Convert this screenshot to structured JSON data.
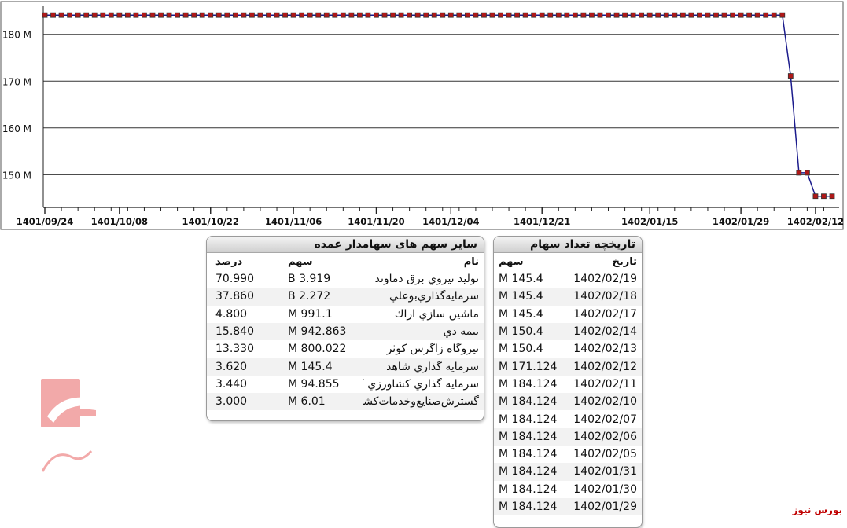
{
  "chart_data": {
    "type": "line",
    "y_ticks": [
      "180 M",
      "170 M",
      "160 M",
      "150 M"
    ],
    "y_tick_values": [
      180,
      170,
      160,
      150
    ],
    "ylim": [
      143,
      186
    ],
    "grid": true,
    "x_tick_labels": [
      "1401/09/24",
      "1401/10/08",
      "1401/10/22",
      "1401/11/06",
      "1401/11/20",
      "1401/12/04",
      "1401/12/21",
      "1402/01/15",
      "1402/01/29",
      "1402/02/12"
    ],
    "series": [
      {
        "color": "#1b1b8c",
        "marker_color": "#b01818",
        "values": [
          184.124,
          184.124,
          184.124,
          184.124,
          184.124,
          184.124,
          184.124,
          184.124,
          184.124,
          184.124,
          184.124,
          184.124,
          184.124,
          184.124,
          184.124,
          184.124,
          184.124,
          184.124,
          184.124,
          184.124,
          184.124,
          184.124,
          184.124,
          184.124,
          184.124,
          184.124,
          184.124,
          184.124,
          184.124,
          184.124,
          184.124,
          184.124,
          184.124,
          184.124,
          184.124,
          184.124,
          184.124,
          184.124,
          184.124,
          184.124,
          184.124,
          184.124,
          184.124,
          184.124,
          184.124,
          184.124,
          184.124,
          184.124,
          184.124,
          184.124,
          184.124,
          184.124,
          184.124,
          184.124,
          184.124,
          184.124,
          184.124,
          184.124,
          184.124,
          184.124,
          184.124,
          184.124,
          184.124,
          184.124,
          184.124,
          184.124,
          184.124,
          184.124,
          184.124,
          184.124,
          184.124,
          184.124,
          184.124,
          184.124,
          184.124,
          184.124,
          184.124,
          184.124,
          184.124,
          184.124,
          184.124,
          184.124,
          184.124,
          184.124,
          184.124,
          184.124,
          184.124,
          184.124,
          184.124,
          184.124,
          171.124,
          150.4,
          150.4,
          145.4,
          145.4,
          145.4
        ]
      }
    ]
  },
  "holders": {
    "title": "ساير سهم هاى سهامدار عمده",
    "headers": {
      "name": "نام",
      "share": "سهم",
      "pct": "درصد"
    },
    "rows": [
      {
        "name": "توليد نيروي برق دماوند",
        "share": "3.919 B",
        "pct": "70.990"
      },
      {
        "name": "سرمايه‌گذاري‌بوعلي",
        "share": "2.272 B",
        "pct": "37.860"
      },
      {
        "name": "ماشين سازي اراك",
        "share": "991.1 M",
        "pct": "4.800"
      },
      {
        "name": "بيمه دي",
        "share": "942.863 M",
        "pct": "15.840"
      },
      {
        "name": "نيروگاه زاگرس كوثر",
        "share": "800.022 M",
        "pct": "13.330"
      },
      {
        "name": "سرمايه گذاري شاهد",
        "share": "145.4 M",
        "pct": "3.620"
      },
      {
        "name": "سرمايه گذاري كشاورزي كوثر",
        "share": "94.855 M",
        "pct": "3.440"
      },
      {
        "name": "گسترش‌صنايع‌وخدمات‌كشاورزي",
        "share": "6.01 M",
        "pct": "3.000"
      }
    ]
  },
  "history": {
    "title": "تاريخچه تعداد سهام",
    "headers": {
      "date": "تاريخ",
      "shares": "سهم"
    },
    "rows": [
      {
        "date": "1402/02/19",
        "shares": "145.4 M"
      },
      {
        "date": "1402/02/18",
        "shares": "145.4 M"
      },
      {
        "date": "1402/02/17",
        "shares": "145.4 M"
      },
      {
        "date": "1402/02/14",
        "shares": "150.4 M"
      },
      {
        "date": "1402/02/13",
        "shares": "150.4 M"
      },
      {
        "date": "1402/02/12",
        "shares": "171.124 M"
      },
      {
        "date": "1402/02/11",
        "shares": "184.124 M"
      },
      {
        "date": "1402/02/10",
        "shares": "184.124 M"
      },
      {
        "date": "1402/02/07",
        "shares": "184.124 M"
      },
      {
        "date": "1402/02/06",
        "shares": "184.124 M"
      },
      {
        "date": "1402/02/05",
        "shares": "184.124 M"
      },
      {
        "date": "1402/01/31",
        "shares": "184.124 M"
      },
      {
        "date": "1402/01/30",
        "shares": "184.124 M"
      },
      {
        "date": "1402/01/29",
        "shares": "184.124 M"
      }
    ]
  },
  "watermark_text": "بورس نیوز",
  "brand": "بورس نيوز"
}
